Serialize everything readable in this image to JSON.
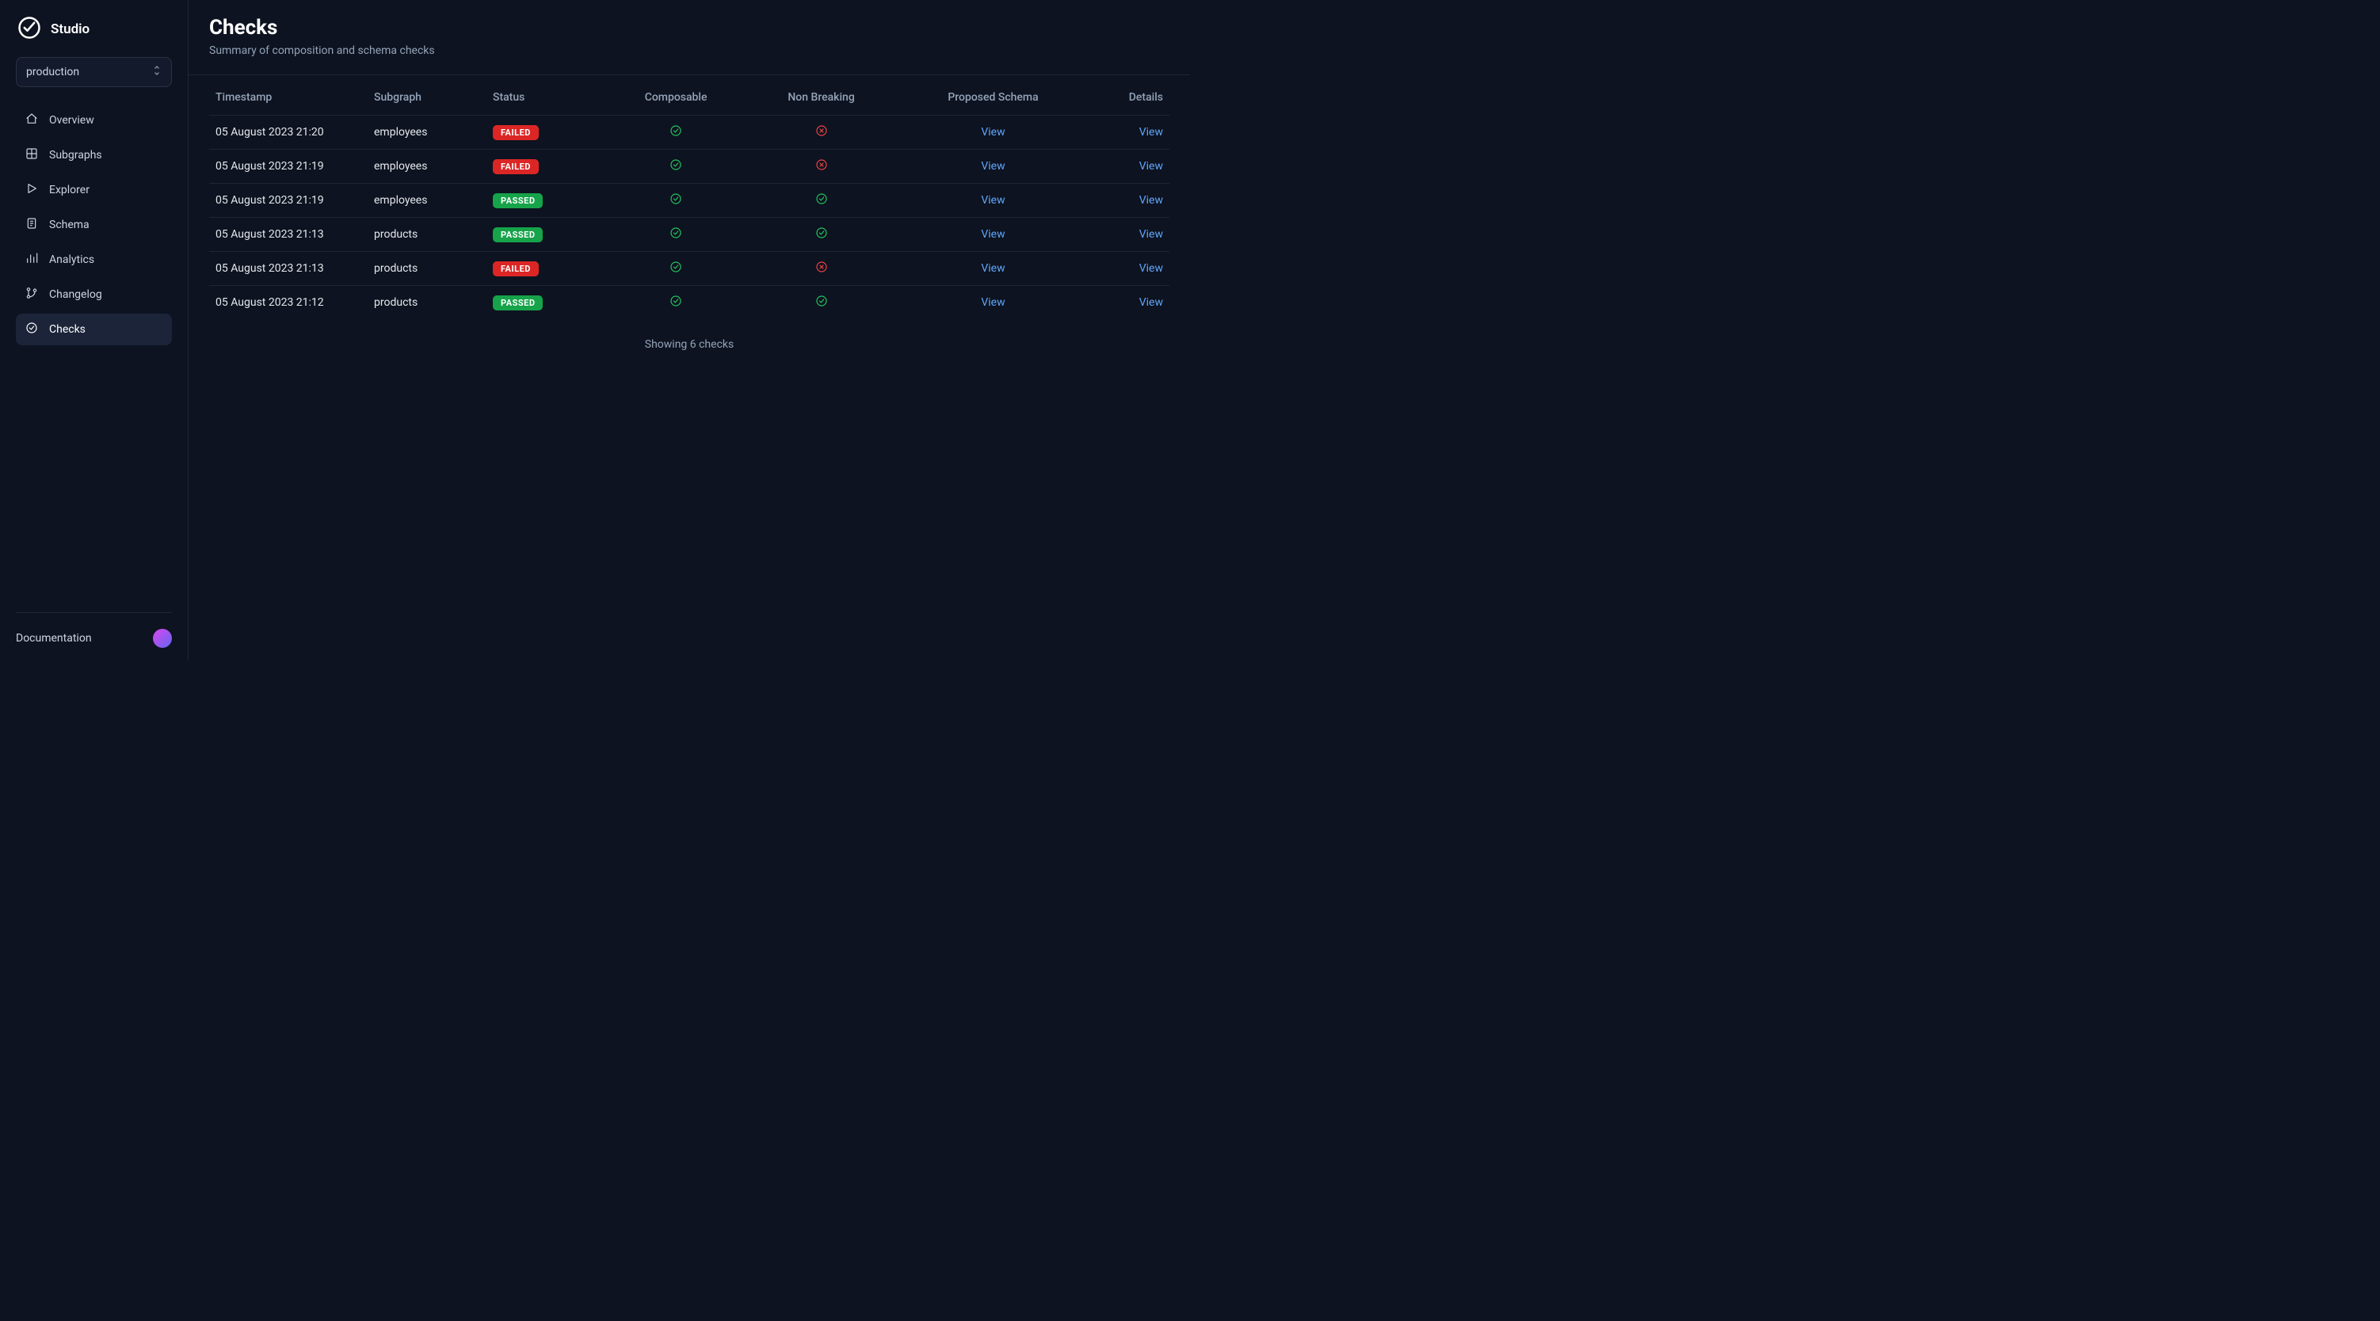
{
  "brand": "Studio",
  "env_selector": {
    "value": "production"
  },
  "nav": {
    "items": [
      {
        "label": "Overview",
        "icon": "home-icon"
      },
      {
        "label": "Subgraphs",
        "icon": "grid-icon"
      },
      {
        "label": "Explorer",
        "icon": "play-icon"
      },
      {
        "label": "Schema",
        "icon": "document-icon"
      },
      {
        "label": "Analytics",
        "icon": "chart-icon"
      },
      {
        "label": "Changelog",
        "icon": "branch-icon"
      },
      {
        "label": "Checks",
        "icon": "check-circle-icon",
        "active": true
      }
    ],
    "documentation_label": "Documentation"
  },
  "page": {
    "title": "Checks",
    "subtitle": "Summary of composition and schema checks"
  },
  "table": {
    "columns": {
      "timestamp": "Timestamp",
      "subgraph": "Subgraph",
      "status": "Status",
      "composable": "Composable",
      "non_breaking": "Non Breaking",
      "proposed_schema": "Proposed Schema",
      "details": "Details"
    },
    "view_label": "View",
    "status_labels": {
      "failed": "FAILED",
      "passed": "PASSED"
    },
    "rows": [
      {
        "timestamp": "05 August 2023 21:20",
        "subgraph": "employees",
        "status": "failed",
        "composable": true,
        "non_breaking": false
      },
      {
        "timestamp": "05 August 2023 21:19",
        "subgraph": "employees",
        "status": "failed",
        "composable": true,
        "non_breaking": false
      },
      {
        "timestamp": "05 August 2023 21:19",
        "subgraph": "employees",
        "status": "passed",
        "composable": true,
        "non_breaking": true
      },
      {
        "timestamp": "05 August 2023 21:13",
        "subgraph": "products",
        "status": "passed",
        "composable": true,
        "non_breaking": true
      },
      {
        "timestamp": "05 August 2023 21:13",
        "subgraph": "products",
        "status": "failed",
        "composable": true,
        "non_breaking": false
      },
      {
        "timestamp": "05 August 2023 21:12",
        "subgraph": "products",
        "status": "passed",
        "composable": true,
        "non_breaking": true
      }
    ],
    "footer": "Showing 6 checks"
  }
}
